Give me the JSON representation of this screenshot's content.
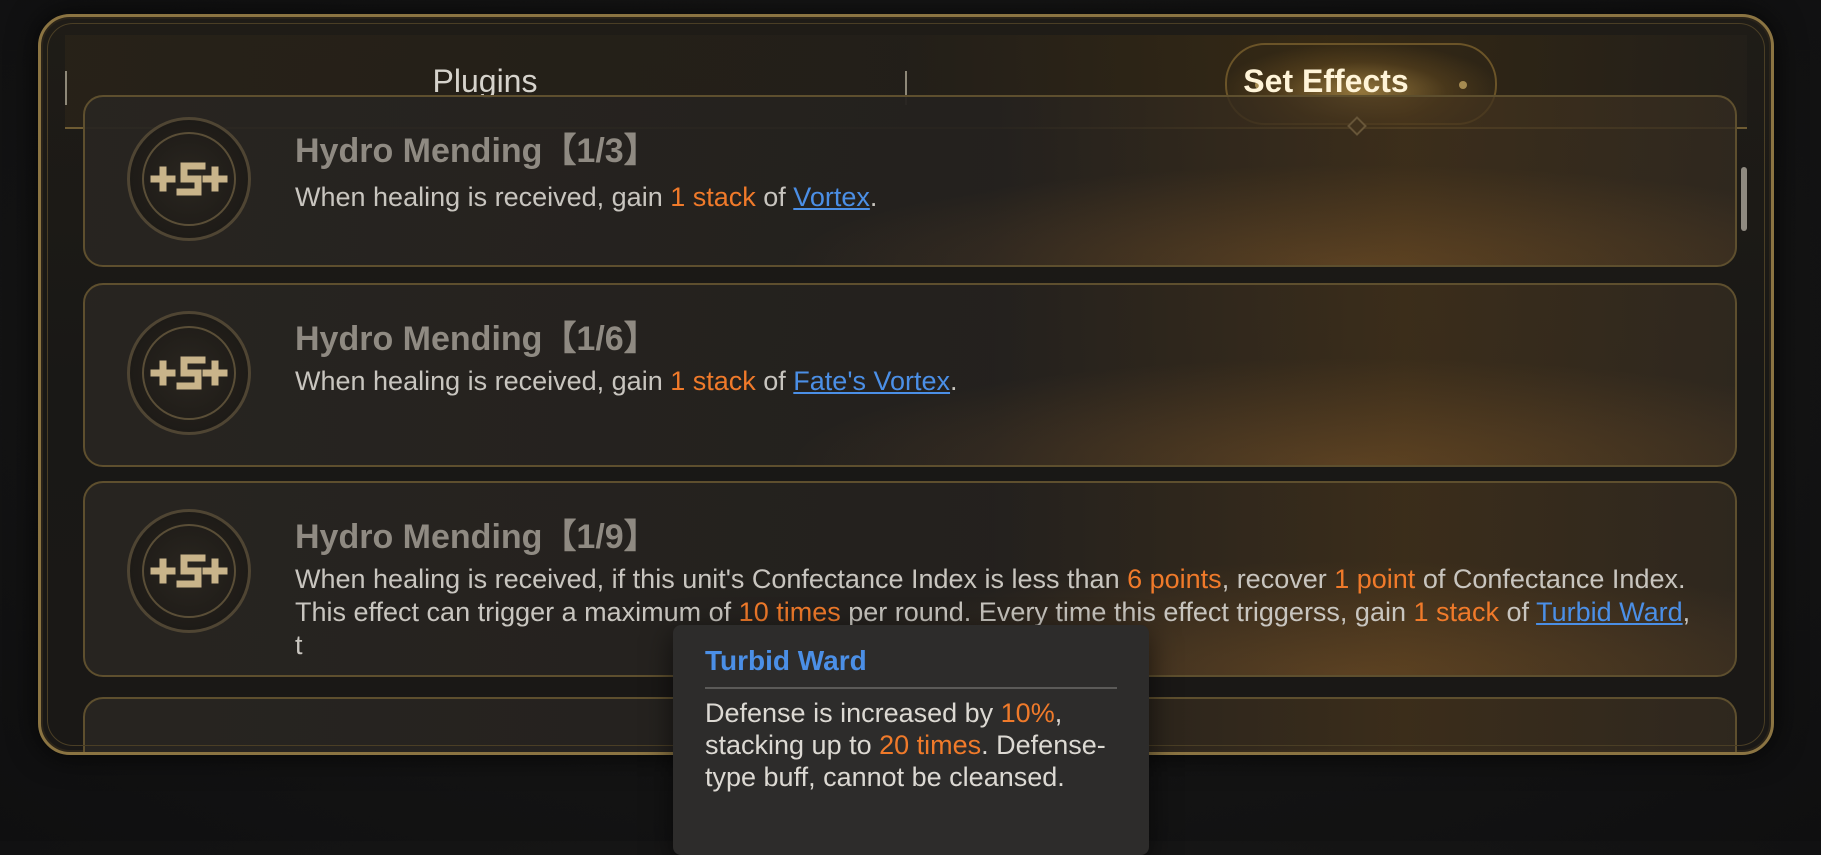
{
  "tabs": {
    "plugins": "Plugins",
    "set_effects": "Set Effects",
    "active": "set_effects"
  },
  "cards": [
    {
      "title": "Hydro Mending【1/3】",
      "desc": [
        {
          "text": "When healing is received, gain "
        },
        {
          "text": "1 stack",
          "style": "highlight"
        },
        {
          "text": " of "
        },
        {
          "text": "Vortex",
          "style": "link"
        },
        {
          "text": "."
        }
      ]
    },
    {
      "title": "Hydro Mending【1/6】",
      "desc": [
        {
          "text": "When healing is received, gain "
        },
        {
          "text": "1 stack",
          "style": "highlight"
        },
        {
          "text": " of "
        },
        {
          "text": "Fate's Vortex",
          "style": "link"
        },
        {
          "text": "."
        }
      ]
    },
    {
      "title": "Hydro Mending【1/9】",
      "desc": [
        {
          "text": "When healing is received, if this unit's Confectance Index is less than "
        },
        {
          "text": "6 points",
          "style": "highlight"
        },
        {
          "text": ", recover "
        },
        {
          "text": "1 point",
          "style": "highlight"
        },
        {
          "text": " of Confectance Index. This effect can trigger a maximum of "
        },
        {
          "text": "10 times",
          "style": "highlight"
        },
        {
          "text": " per round. Every time this effect triggerss, gain "
        },
        {
          "text": "1 stack",
          "style": "highlight"
        },
        {
          "text": " of "
        },
        {
          "text": "Turbid Ward",
          "style": "link"
        },
        {
          "text": ", t"
        }
      ]
    }
  ],
  "tooltip": {
    "title": "Turbid Ward",
    "body": [
      {
        "text": "Defense is increased by "
      },
      {
        "text": "10%",
        "style": "highlight"
      },
      {
        "text": ", stacking up to "
      },
      {
        "text": "20 times",
        "style": "highlight"
      },
      {
        "text": ". Defense-type buff, cannot be cleansed."
      }
    ]
  },
  "colors": {
    "highlight": "#f07a2a",
    "link": "#4b8fe6",
    "frame_gold": "#8b7442"
  },
  "icons": {
    "card_emblem": "hydro-mending-emblem-icon"
  }
}
